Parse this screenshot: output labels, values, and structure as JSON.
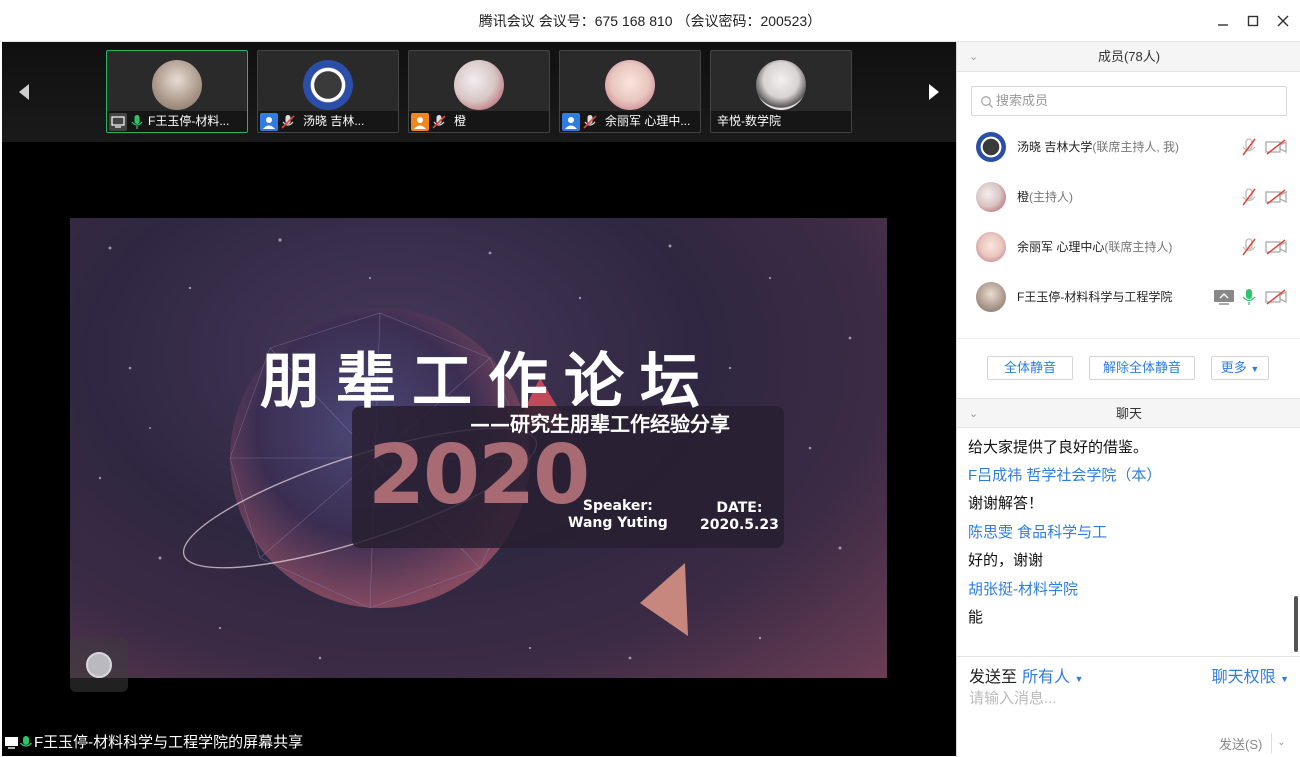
{
  "titlebar": {
    "title": "腾讯会议 会议号：675 168 810 （会议密码：200523）"
  },
  "thumbnails": [
    {
      "name": "F王玉停-材料...",
      "active": true,
      "avatar_color": "#a99689"
    },
    {
      "name": "汤晓 吉林...",
      "active": false,
      "avatar_color": "#2b4fa8"
    },
    {
      "name": "橙",
      "active": false,
      "avatar_color": "#d8c6c6"
    },
    {
      "name": "余丽军 心理中...",
      "active": false,
      "avatar_color": "#e8c7c0"
    },
    {
      "name": "辛悦-数学院",
      "active": false,
      "avatar_color": "#d8d2d2"
    }
  ],
  "slide": {
    "title": "朋辈工作论坛",
    "subtitle": "——研究生朋辈工作经验分享",
    "year": "2020",
    "speaker_label": "Speaker:",
    "speaker_name": "Wang Yuting",
    "date_label": "DATE:",
    "date_value": "2020.5.23"
  },
  "share_bar": {
    "text": "F王玉停-材料科学与工程学院的屏幕共享"
  },
  "members": {
    "header": "成员(78人)",
    "search_placeholder": "搜索成员",
    "list": [
      {
        "name": "汤晓 吉林大学",
        "role": "(联席主持人, 我)",
        "avatar_color": "#2b4fa8",
        "mic": "muted",
        "cam": "off"
      },
      {
        "name": "橙",
        "role": "(主持人)",
        "avatar_color": "#d9c3c3",
        "mic": "muted",
        "cam": "off"
      },
      {
        "name": "余丽军 心理中心",
        "role": "(联席主持人)",
        "avatar_color": "#e8c7c0",
        "mic": "muted",
        "cam": "off"
      },
      {
        "name": "F王玉停-材料科学与工程学院",
        "role": "",
        "avatar_color": "#a99689",
        "mic": "on",
        "cam": "off",
        "sharing": true
      }
    ],
    "mute_all": "全体静音",
    "unmute_all": "解除全体静音",
    "more": "更多"
  },
  "chat": {
    "header": "聊天",
    "messages": [
      {
        "type": "msg",
        "text": "给大家提供了良好的借鉴。"
      },
      {
        "type": "sender",
        "text": "F吕成祎 哲学社会学院（本）"
      },
      {
        "type": "msg",
        "text": "谢谢解答！"
      },
      {
        "type": "sender",
        "text": "陈思雯 食品科学与工"
      },
      {
        "type": "msg",
        "text": "好的，谢谢"
      },
      {
        "type": "sender",
        "text": "胡张挺-材料学院"
      },
      {
        "type": "msg",
        "text": "能"
      }
    ],
    "send_to_label": "发送至",
    "send_to_target": "所有人",
    "permissions": "聊天权限",
    "input_placeholder": "请输入消息...",
    "send_button": "发送(S)"
  },
  "colors": {
    "accent_blue": "#2f7de1",
    "active_green": "#27b35f",
    "muted_red": "#e0453a"
  }
}
